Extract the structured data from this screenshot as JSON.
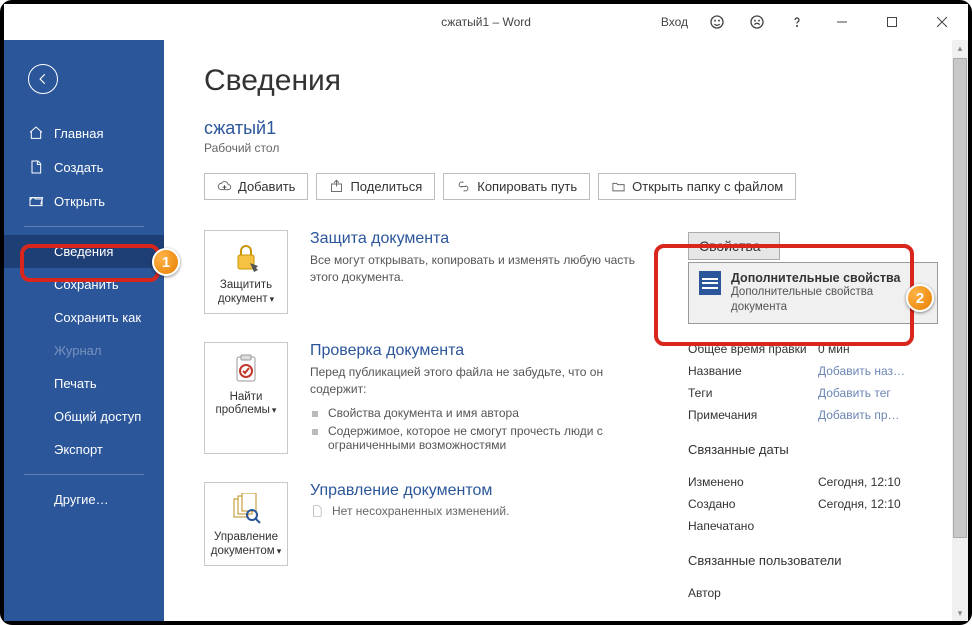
{
  "titlebar": {
    "title": "сжатый1  –  Word",
    "login": "Вход"
  },
  "sidebar": {
    "items": [
      {
        "label": "Главная"
      },
      {
        "label": "Создать"
      },
      {
        "label": "Открыть"
      },
      {
        "label": "Сведения"
      },
      {
        "label": "Сохранить"
      },
      {
        "label": "Сохранить как"
      },
      {
        "label": "Журнал"
      },
      {
        "label": "Печать"
      },
      {
        "label": "Общий доступ"
      },
      {
        "label": "Экспорт"
      },
      {
        "label": "Другие…"
      }
    ]
  },
  "page": {
    "title": "Сведения",
    "doc_title": "сжатый1",
    "doc_location": "Рабочий стол"
  },
  "toolbar": {
    "add": "Добавить",
    "share": "Поделиться",
    "copy_path": "Копировать путь",
    "open_folder": "Открыть папку с файлом"
  },
  "sections": {
    "protect": {
      "btn": "Защитить документ",
      "title": "Защита документа",
      "desc": "Все могут открывать, копировать и изменять любую часть этого документа."
    },
    "inspect": {
      "btn": "Найти проблемы",
      "title": "Проверка документа",
      "desc": "Перед публикацией этого файла не забудьте, что он содержит:",
      "items": [
        "Свойства документа и имя автора",
        "Содержимое, которое не смогут прочесть люди с ограниченными возможностями"
      ]
    },
    "manage": {
      "btn": "Управление документом",
      "title": "Управление документом",
      "no_edits": "Нет несохраненных изменений."
    }
  },
  "props": {
    "header": "Свойства",
    "dropdown": {
      "title": "Дополнительные свойства",
      "sub": "Дополнительные свойства документа"
    },
    "rows": {
      "edit_time_label": "Общее время правки",
      "edit_time_val": "0 мин",
      "name_label": "Название",
      "name_val": "Добавить наз…",
      "tags_label": "Теги",
      "tags_val": "Добавить тег",
      "notes_label": "Примечания",
      "notes_val": "Добавить пр…"
    },
    "dates_header": "Связанные даты",
    "dates": {
      "changed_label": "Изменено",
      "changed_val": "Сегодня, 12:10",
      "created_label": "Создано",
      "created_val": "Сегодня, 12:10",
      "printed_label": "Напечатано",
      "printed_val": ""
    },
    "users_header": "Связанные пользователи",
    "author_label": "Автор"
  },
  "annotations": {
    "a1": "1",
    "a2": "2"
  }
}
